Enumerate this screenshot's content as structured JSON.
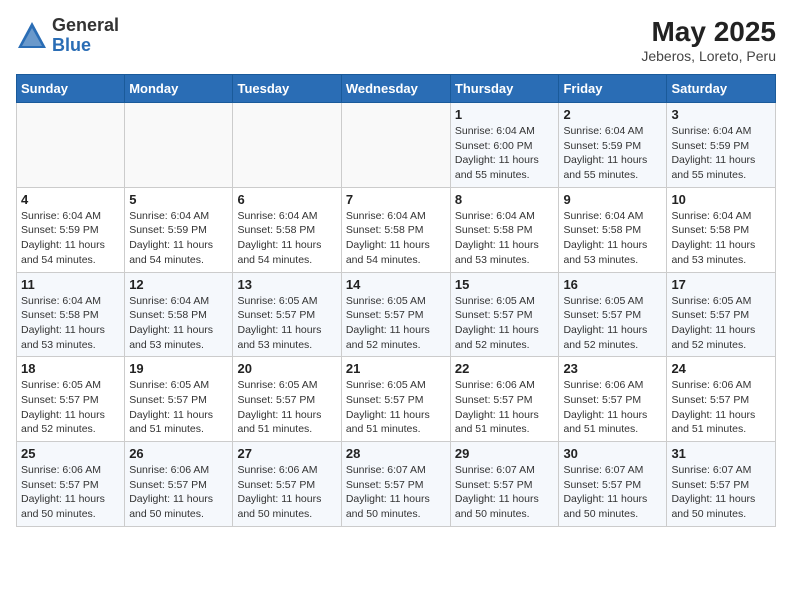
{
  "logo": {
    "line1": "General",
    "line2": "Blue"
  },
  "title": {
    "month_year": "May 2025",
    "location": "Jeberos, Loreto, Peru"
  },
  "weekdays": [
    "Sunday",
    "Monday",
    "Tuesday",
    "Wednesday",
    "Thursday",
    "Friday",
    "Saturday"
  ],
  "weeks": [
    [
      {
        "day": "",
        "detail": ""
      },
      {
        "day": "",
        "detail": ""
      },
      {
        "day": "",
        "detail": ""
      },
      {
        "day": "",
        "detail": ""
      },
      {
        "day": "1",
        "detail": "Sunrise: 6:04 AM\nSunset: 6:00 PM\nDaylight: 11 hours\nand 55 minutes."
      },
      {
        "day": "2",
        "detail": "Sunrise: 6:04 AM\nSunset: 5:59 PM\nDaylight: 11 hours\nand 55 minutes."
      },
      {
        "day": "3",
        "detail": "Sunrise: 6:04 AM\nSunset: 5:59 PM\nDaylight: 11 hours\nand 55 minutes."
      }
    ],
    [
      {
        "day": "4",
        "detail": "Sunrise: 6:04 AM\nSunset: 5:59 PM\nDaylight: 11 hours\nand 54 minutes."
      },
      {
        "day": "5",
        "detail": "Sunrise: 6:04 AM\nSunset: 5:59 PM\nDaylight: 11 hours\nand 54 minutes."
      },
      {
        "day": "6",
        "detail": "Sunrise: 6:04 AM\nSunset: 5:58 PM\nDaylight: 11 hours\nand 54 minutes."
      },
      {
        "day": "7",
        "detail": "Sunrise: 6:04 AM\nSunset: 5:58 PM\nDaylight: 11 hours\nand 54 minutes."
      },
      {
        "day": "8",
        "detail": "Sunrise: 6:04 AM\nSunset: 5:58 PM\nDaylight: 11 hours\nand 53 minutes."
      },
      {
        "day": "9",
        "detail": "Sunrise: 6:04 AM\nSunset: 5:58 PM\nDaylight: 11 hours\nand 53 minutes."
      },
      {
        "day": "10",
        "detail": "Sunrise: 6:04 AM\nSunset: 5:58 PM\nDaylight: 11 hours\nand 53 minutes."
      }
    ],
    [
      {
        "day": "11",
        "detail": "Sunrise: 6:04 AM\nSunset: 5:58 PM\nDaylight: 11 hours\nand 53 minutes."
      },
      {
        "day": "12",
        "detail": "Sunrise: 6:04 AM\nSunset: 5:58 PM\nDaylight: 11 hours\nand 53 minutes."
      },
      {
        "day": "13",
        "detail": "Sunrise: 6:05 AM\nSunset: 5:57 PM\nDaylight: 11 hours\nand 53 minutes."
      },
      {
        "day": "14",
        "detail": "Sunrise: 6:05 AM\nSunset: 5:57 PM\nDaylight: 11 hours\nand 52 minutes."
      },
      {
        "day": "15",
        "detail": "Sunrise: 6:05 AM\nSunset: 5:57 PM\nDaylight: 11 hours\nand 52 minutes."
      },
      {
        "day": "16",
        "detail": "Sunrise: 6:05 AM\nSunset: 5:57 PM\nDaylight: 11 hours\nand 52 minutes."
      },
      {
        "day": "17",
        "detail": "Sunrise: 6:05 AM\nSunset: 5:57 PM\nDaylight: 11 hours\nand 52 minutes."
      }
    ],
    [
      {
        "day": "18",
        "detail": "Sunrise: 6:05 AM\nSunset: 5:57 PM\nDaylight: 11 hours\nand 52 minutes."
      },
      {
        "day": "19",
        "detail": "Sunrise: 6:05 AM\nSunset: 5:57 PM\nDaylight: 11 hours\nand 51 minutes."
      },
      {
        "day": "20",
        "detail": "Sunrise: 6:05 AM\nSunset: 5:57 PM\nDaylight: 11 hours\nand 51 minutes."
      },
      {
        "day": "21",
        "detail": "Sunrise: 6:05 AM\nSunset: 5:57 PM\nDaylight: 11 hours\nand 51 minutes."
      },
      {
        "day": "22",
        "detail": "Sunrise: 6:06 AM\nSunset: 5:57 PM\nDaylight: 11 hours\nand 51 minutes."
      },
      {
        "day": "23",
        "detail": "Sunrise: 6:06 AM\nSunset: 5:57 PM\nDaylight: 11 hours\nand 51 minutes."
      },
      {
        "day": "24",
        "detail": "Sunrise: 6:06 AM\nSunset: 5:57 PM\nDaylight: 11 hours\nand 51 minutes."
      }
    ],
    [
      {
        "day": "25",
        "detail": "Sunrise: 6:06 AM\nSunset: 5:57 PM\nDaylight: 11 hours\nand 50 minutes."
      },
      {
        "day": "26",
        "detail": "Sunrise: 6:06 AM\nSunset: 5:57 PM\nDaylight: 11 hours\nand 50 minutes."
      },
      {
        "day": "27",
        "detail": "Sunrise: 6:06 AM\nSunset: 5:57 PM\nDaylight: 11 hours\nand 50 minutes."
      },
      {
        "day": "28",
        "detail": "Sunrise: 6:07 AM\nSunset: 5:57 PM\nDaylight: 11 hours\nand 50 minutes."
      },
      {
        "day": "29",
        "detail": "Sunrise: 6:07 AM\nSunset: 5:57 PM\nDaylight: 11 hours\nand 50 minutes."
      },
      {
        "day": "30",
        "detail": "Sunrise: 6:07 AM\nSunset: 5:57 PM\nDaylight: 11 hours\nand 50 minutes."
      },
      {
        "day": "31",
        "detail": "Sunrise: 6:07 AM\nSunset: 5:57 PM\nDaylight: 11 hours\nand 50 minutes."
      }
    ]
  ]
}
